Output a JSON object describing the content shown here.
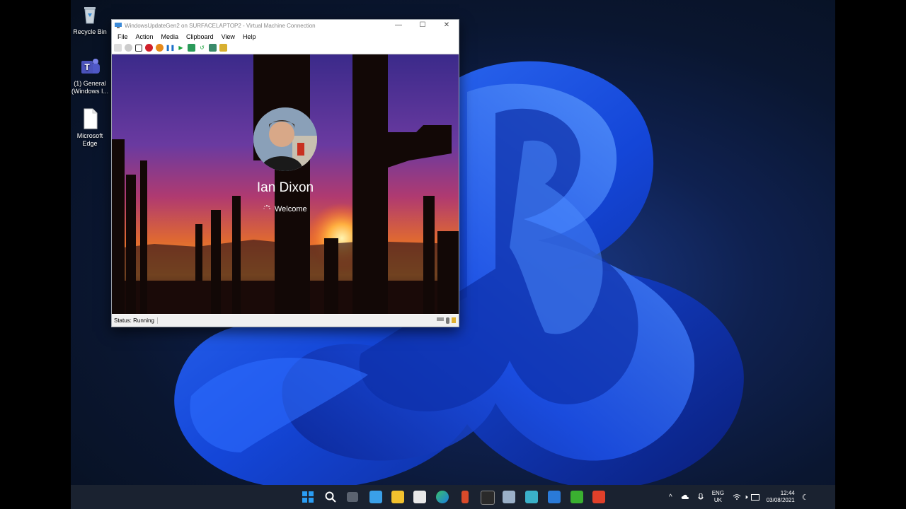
{
  "desktop": {
    "icons": [
      {
        "label": "Recycle Bin"
      },
      {
        "label": "(1) General (Windows I..."
      },
      {
        "label": "Microsoft Edge"
      }
    ]
  },
  "vm_window": {
    "title": "WindowsUpdateGen2 on SURFACELAPTOP2 - Virtual Machine Connection",
    "controls": {
      "minimize": "—",
      "maximize": "☐",
      "close": "✕"
    },
    "menu": [
      "File",
      "Action",
      "Media",
      "Clipboard",
      "View",
      "Help"
    ],
    "login": {
      "user_name": "Ian Dixon",
      "message": "Welcome"
    },
    "status": "Status: Running"
  },
  "taskbar": {
    "language": {
      "line1": "ENG",
      "line2": "UK"
    },
    "clock": {
      "time": "12:44",
      "date": "03/08/2021"
    }
  },
  "colors": {
    "accent": "#0078d4",
    "taskbar_bg": "#1a2230"
  }
}
